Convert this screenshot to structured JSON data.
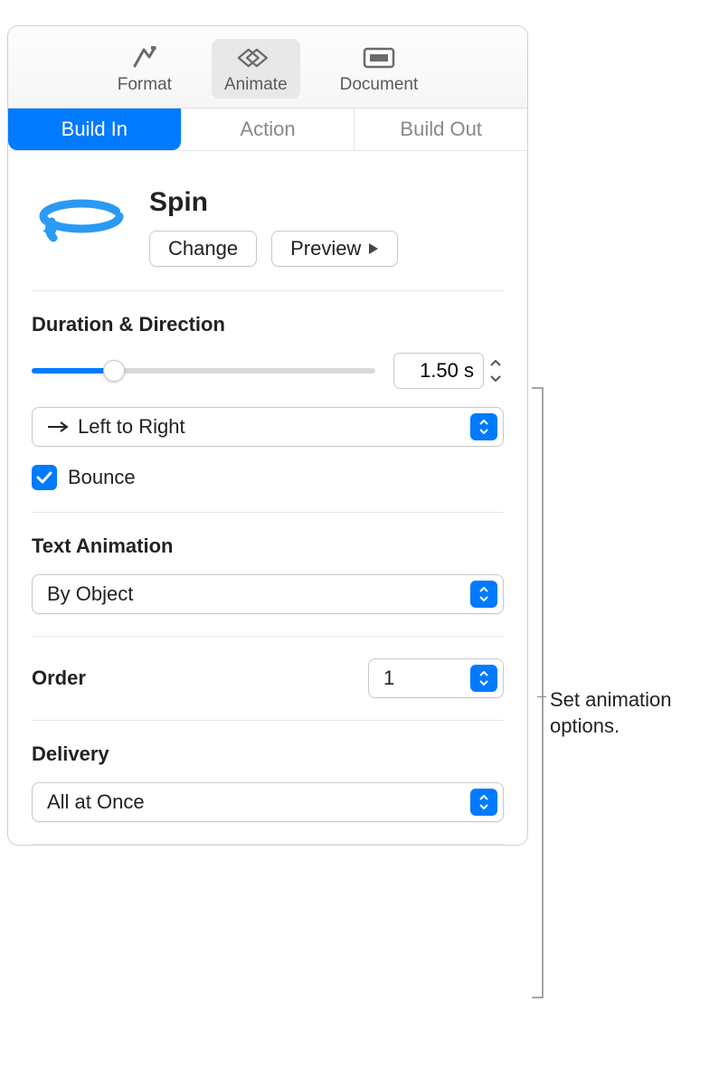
{
  "toolbar": {
    "format": "Format",
    "animate": "Animate",
    "document": "Document"
  },
  "tabs": {
    "buildIn": "Build In",
    "action": "Action",
    "buildOut": "Build Out"
  },
  "effect": {
    "title": "Spin",
    "changeLabel": "Change",
    "previewLabel": "Preview"
  },
  "durationDirection": {
    "label": "Duration & Direction",
    "value": "1.50 s",
    "direction": "Left to Right",
    "bounce": "Bounce"
  },
  "textAnimation": {
    "label": "Text Animation",
    "value": "By Object"
  },
  "order": {
    "label": "Order",
    "value": "1"
  },
  "delivery": {
    "label": "Delivery",
    "value": "All at Once"
  },
  "callout": "Set animation options."
}
